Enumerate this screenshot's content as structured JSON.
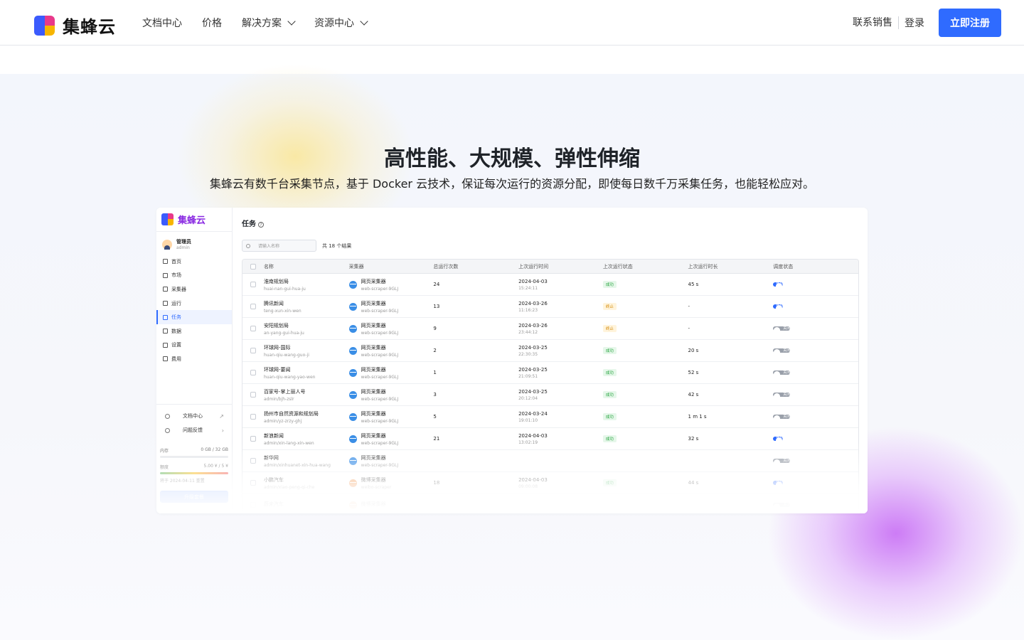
{
  "nav": {
    "brand": "集蜂云",
    "links": [
      "文档中心",
      "价格",
      "解决方案",
      "资源中心"
    ],
    "sales": "联系销售",
    "login": "登录",
    "signup": "立即注册"
  },
  "hero": {
    "title": "高性能、大规模、弹性伸缩",
    "subtitle": "集蜂云有数千台采集节点，基于 Docker 云技术，保证每次运行的资源分配，即使每日数千万采集任务，也能轻松应对。"
  },
  "app": {
    "brand": "集蜂云",
    "user": {
      "name": "管理员",
      "role": "admin"
    },
    "menu": [
      "首页",
      "市场",
      "采集器",
      "运行",
      "任务",
      "数据",
      "设置",
      "费用"
    ],
    "active_menu": "任务",
    "bottom_links": [
      "文档中心",
      "问题反馈"
    ],
    "resources": {
      "memory_label": "内存",
      "memory_value": "0 GB / 32 GB",
      "quota_label": "额度",
      "quota_value": "5.00 ¥ / 5 ¥",
      "reset_text": "将于 2024-04-11 重置",
      "upgrade": "升级套餐"
    },
    "page_title": "任务",
    "search_placeholder": "请输入名称",
    "result_count": "共 18 个结果",
    "columns": [
      "名称",
      "采集器",
      "总运行次数",
      "上次运行时间",
      "上次运行状态",
      "上次运行时长",
      "调度状态"
    ],
    "rows": [
      {
        "name": "淮南规划局",
        "slug": "huai-nan-gui-hua-ju",
        "scraper": "网页采集器",
        "scraper_id": "web-scraper-9GLJ",
        "runs": "24",
        "date": "2024-04-03",
        "time": "15:24:11",
        "status": "成功",
        "status_type": "ok",
        "duration": "45 s",
        "schedule": "开启",
        "schedule_on": true
      },
      {
        "name": "腾讯新闻",
        "slug": "teng-xun-xin-wen",
        "scraper": "网页采集器",
        "scraper_id": "web-scraper-9GLJ",
        "runs": "13",
        "date": "2024-03-26",
        "time": "11:16:23",
        "status": "终止",
        "status_type": "stop",
        "duration": "-",
        "schedule": "开启",
        "schedule_on": true
      },
      {
        "name": "安阳规划局",
        "slug": "an-yang-gui-hua-ju",
        "scraper": "网页采集器",
        "scraper_id": "web-scraper-9GLJ",
        "runs": "9",
        "date": "2024-03-26",
        "time": "23:44:12",
        "status": "终止",
        "status_type": "stop",
        "duration": "-",
        "schedule": "关闭",
        "schedule_on": false
      },
      {
        "name": "环球网-国际",
        "slug": "huan-qiu-wang-guo-ji",
        "scraper": "网页采集器",
        "scraper_id": "web-scraper-9GLJ",
        "runs": "2",
        "date": "2024-03-25",
        "time": "22:30:35",
        "status": "成功",
        "status_type": "ok",
        "duration": "20 s",
        "schedule": "关闭",
        "schedule_on": false
      },
      {
        "name": "环球网-要闻",
        "slug": "huan-qiu-wang-yao-wen",
        "scraper": "网页采集器",
        "scraper_id": "web-scraper-9GLJ",
        "runs": "1",
        "date": "2024-03-25",
        "time": "21:09:51",
        "status": "成功",
        "status_type": "ok",
        "duration": "52 s",
        "schedule": "关闭",
        "schedule_on": false
      },
      {
        "name": "百家号-掌上丽人号",
        "slug": "admin/bjh-zslr",
        "scraper": "网页采集器",
        "scraper_id": "web-scraper-9GLJ",
        "runs": "3",
        "date": "2024-03-25",
        "time": "20:12:04",
        "status": "成功",
        "status_type": "ok",
        "duration": "42 s",
        "schedule": "关闭",
        "schedule_on": false
      },
      {
        "name": "扬州市自然资源和规划局",
        "slug": "admin/yz-zrzy-ghj",
        "scraper": "网页采集器",
        "scraper_id": "web-scraper-9GLJ",
        "runs": "5",
        "date": "2024-03-24",
        "time": "19:01:10",
        "status": "成功",
        "status_type": "ok",
        "duration": "1 m 1 s",
        "schedule": "关闭",
        "schedule_on": false
      },
      {
        "name": "新浪新闻",
        "slug": "admin/xin-lang-xin-wen",
        "scraper": "网页采集器",
        "scraper_id": "web-scraper-9GLJ",
        "runs": "21",
        "date": "2024-04-03",
        "time": "13:02:19",
        "status": "成功",
        "status_type": "ok",
        "duration": "32 s",
        "schedule": "开启",
        "schedule_on": true
      },
      {
        "name": "新华网",
        "slug": "admin/xinhuanet-xin-hua-wang",
        "scraper": "网页采集器",
        "scraper_id": "web-scraper-9GLJ",
        "runs": "",
        "date": "",
        "time": "",
        "status": "",
        "status_type": "",
        "duration": "",
        "schedule": "关闭",
        "schedule_on": false
      },
      {
        "name": "小鹏汽车",
        "slug": "admin/xiao-peng-qi-che",
        "scraper": "微博采集器",
        "scraper_id": "weibo-scraper",
        "runs": "18",
        "date": "2024-04-03",
        "time": "09:00:08",
        "status": "成功",
        "status_type": "ok",
        "duration": "44 s",
        "schedule": "开启",
        "schedule_on": true
      },
      {
        "name": "蔚来汽车",
        "slug": "",
        "scraper": "微博采集器",
        "scraper_id": "",
        "runs": "",
        "date": "",
        "time": "",
        "status": "",
        "status_type": "",
        "duration": "",
        "schedule": "关闭",
        "schedule_on": false
      }
    ]
  },
  "colors": {
    "accent": "#2f6bff",
    "brand_purple": "#8a2be2",
    "success": "#22a33b",
    "warning": "#d48806"
  },
  "icons": [
    "chevron-down-icon",
    "search-icon",
    "help-icon",
    "globe-icon",
    "home-icon",
    "gear-icon"
  ]
}
